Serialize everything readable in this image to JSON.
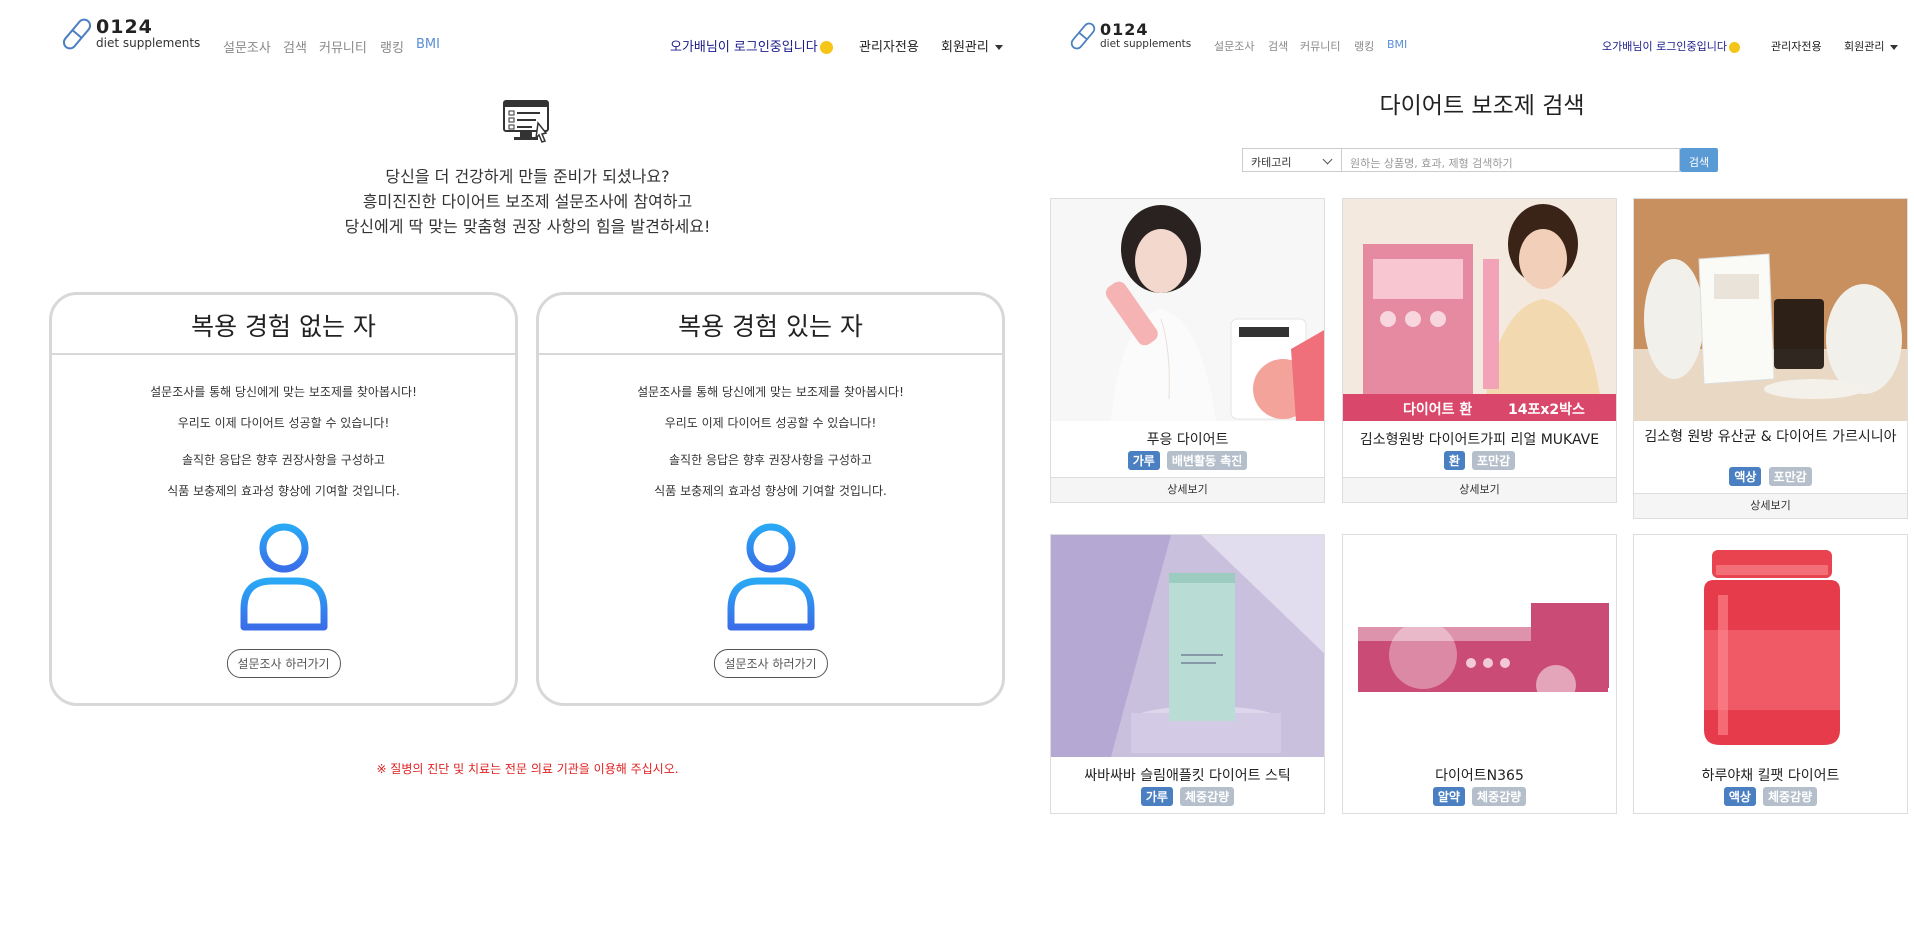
{
  "left": {
    "logo": {
      "num": "0124",
      "sub": "diet supplements"
    },
    "nav": [
      "설문조사",
      "검색",
      "커뮤니티",
      "랭킹",
      "BMI"
    ],
    "user_greeting": "오가배님이 로그인중입니다",
    "admin": "관리자전용",
    "member": "회원관리",
    "intro": [
      "당신을 더 건강하게 만들 준비가 되셨나요?",
      "흥미진진한 다이어트 보조제 설문조사에 참여하고",
      "당신에게 딱 맞는 맞춤형 권장 사항의 힘을 발견하세요!"
    ],
    "cards": [
      {
        "title": "복용 경험 없는 자",
        "desc": [
          "설문조사를 통해 당신에게 맞는 보조제를 찾아봅시다!",
          "우리도 이제 다이어트 성공할 수 있습니다!",
          "솔직한 응답은 향후 권장사항을 구성하고",
          "식품 보충제의 효과성 향상에 기여할 것입니다."
        ],
        "button": "설문조사 하러가기"
      },
      {
        "title": "복용 경험 있는 자",
        "desc": [
          "설문조사를 통해 당신에게 맞는 보조제를 찾아봅시다!",
          "우리도 이제 다이어트 성공할 수 있습니다!",
          "솔직한 응답은 향후 권장사항을 구성하고",
          "식품 보충제의 효과성 향상에 기여할 것입니다."
        ],
        "button": "설문조사 하러가기"
      }
    ],
    "warning": "※ 질병의 진단 및 치료는 전문 의료 기관을 이용해 주십시오."
  },
  "right": {
    "logo": {
      "num": "0124",
      "sub": "diet supplements"
    },
    "nav": [
      "설문조사",
      "검색",
      "커뮤니티",
      "랭킹",
      "BMI"
    ],
    "user_greeting": "오가배님이 로그인중입니다",
    "admin": "관리자전용",
    "member": "회원관리",
    "search_title": "다이어트 보조제 검색",
    "category_select": "카테고리",
    "search_placeholder": "원하는 상품명, 효과, 제형 검색하기",
    "search_button": "검색",
    "products": [
      {
        "name": "푸응 다이어트",
        "tags": [
          {
            "t": "가루",
            "c": "blue"
          },
          {
            "t": "배변활동 촉진",
            "c": "grey"
          }
        ],
        "more": "상세보기"
      },
      {
        "name": "김소형원방 다이어트가피 리얼 MUKAVE",
        "tags": [
          {
            "t": "환",
            "c": "blue"
          },
          {
            "t": "포만감",
            "c": "grey"
          }
        ],
        "more": "상세보기"
      },
      {
        "name": "김소형 원방 유산균 & 다이어트 가르시니아",
        "tags": [
          {
            "t": "액상",
            "c": "blue"
          },
          {
            "t": "포만감",
            "c": "grey"
          }
        ],
        "more": "상세보기"
      },
      {
        "name": "싸바싸바 슬림애플킷 다이어트 스틱",
        "tags": [
          {
            "t": "가루",
            "c": "blue"
          },
          {
            "t": "체중감량",
            "c": "grey"
          }
        ],
        "more": ""
      },
      {
        "name": "다이어트N365",
        "tags": [
          {
            "t": "알약",
            "c": "blue"
          },
          {
            "t": "체중감량",
            "c": "grey"
          }
        ],
        "more": ""
      },
      {
        "name": "하루야채 킬팻 다이어트",
        "tags": [
          {
            "t": "액상",
            "c": "blue"
          },
          {
            "t": "체중감량",
            "c": "grey"
          }
        ],
        "more": ""
      }
    ]
  }
}
